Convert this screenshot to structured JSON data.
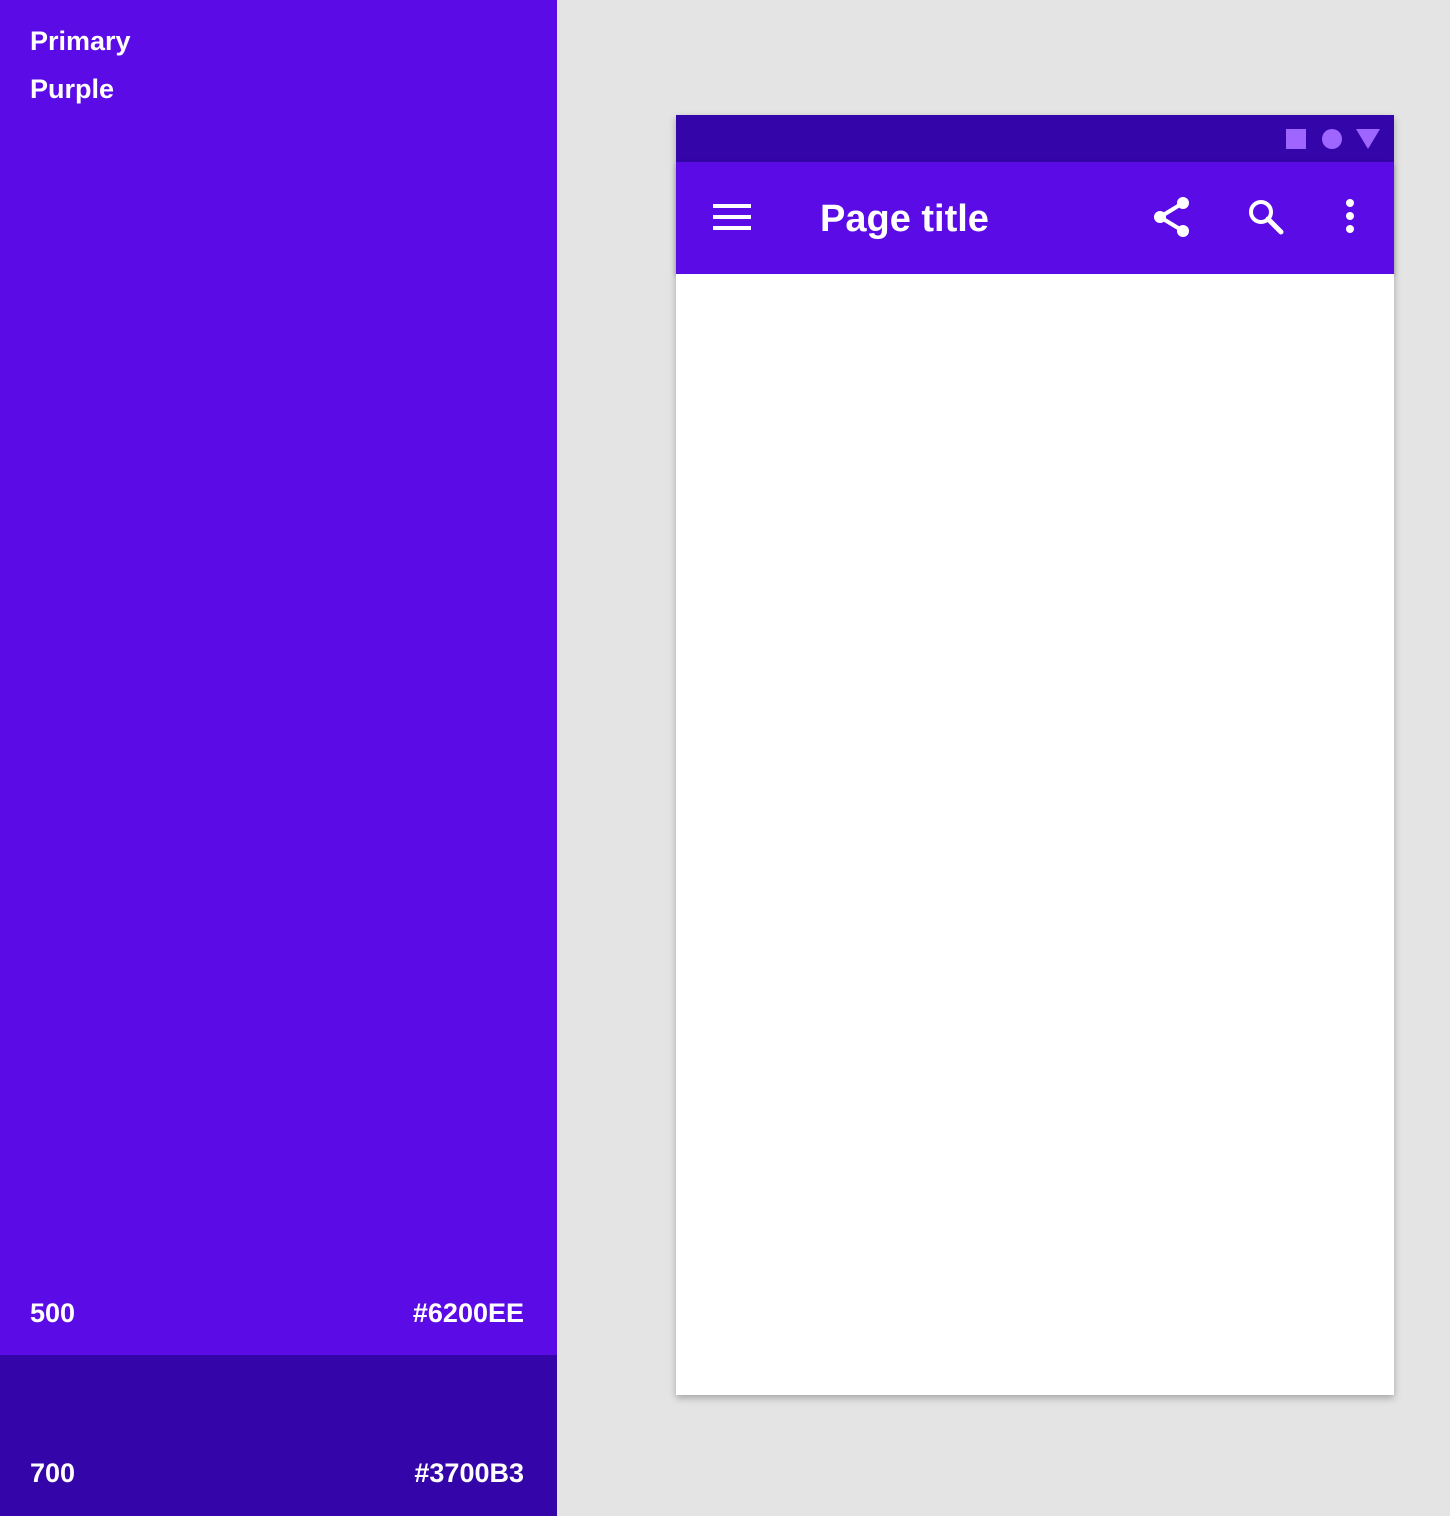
{
  "palette": {
    "heading_line1": "Primary",
    "heading_line2": "Purple",
    "swatches": [
      {
        "shade": "500",
        "hex": "#6200EE",
        "display_color": "#5a0be6"
      },
      {
        "shade": "700",
        "hex": "#3700B3",
        "display_color": "#3405a8"
      }
    ]
  },
  "phone": {
    "status_bar": {
      "background": "#3405a8",
      "icon_color": "#9e66ff",
      "icons": [
        "square-icon",
        "circle-icon",
        "triangle-icon"
      ]
    },
    "app_bar": {
      "background": "#5a0be6",
      "title": "Page title",
      "leading_icon": "menu-icon",
      "actions": [
        "share-icon",
        "search-icon",
        "more-vert-icon"
      ]
    },
    "content_background": "#ffffff"
  },
  "page_background": "#e4e4e4"
}
